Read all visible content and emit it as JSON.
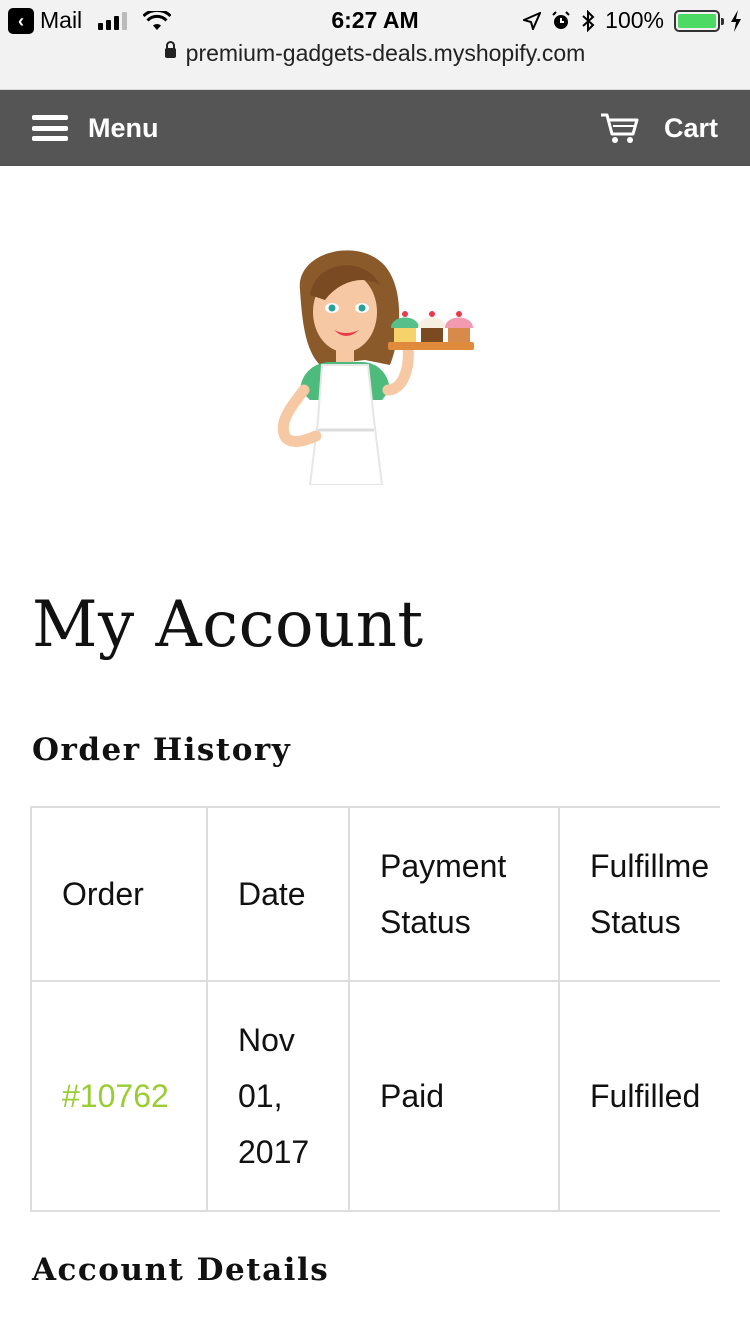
{
  "status_bar": {
    "back_app": "Mail",
    "time": "6:27 AM",
    "battery": "100%",
    "url": "premium-gadgets-deals.myshopify.com"
  },
  "header": {
    "menu_label": "Menu",
    "cart_label": "Cart"
  },
  "page": {
    "title": "My Account",
    "order_history_title": "Order History",
    "account_details_title": "Account Details"
  },
  "orders_table": {
    "headers": [
      "Order",
      "Date",
      "Payment Status",
      "Fulfillme Status"
    ],
    "header_lines": {
      "payment_1": "Payment",
      "payment_2": "Status",
      "fulfillment_1": "Fulfillme",
      "fulfillment_2": "Status"
    },
    "rows": [
      {
        "order": "#10762",
        "date_line1": "Nov",
        "date_line2": "01,",
        "date_line3": "2017",
        "payment_status": "Paid",
        "fulfillment_status": "Fulfilled"
      }
    ]
  },
  "colors": {
    "header_bar": "#555555",
    "link": "#9acd32",
    "border": "#dddddd"
  },
  "icons": [
    "chevron-left-icon",
    "signal-icon",
    "wifi-icon",
    "location-icon",
    "alarm-icon",
    "bluetooth-icon",
    "battery-icon",
    "charging-icon",
    "lock-icon",
    "hamburger-icon",
    "cart-icon"
  ]
}
